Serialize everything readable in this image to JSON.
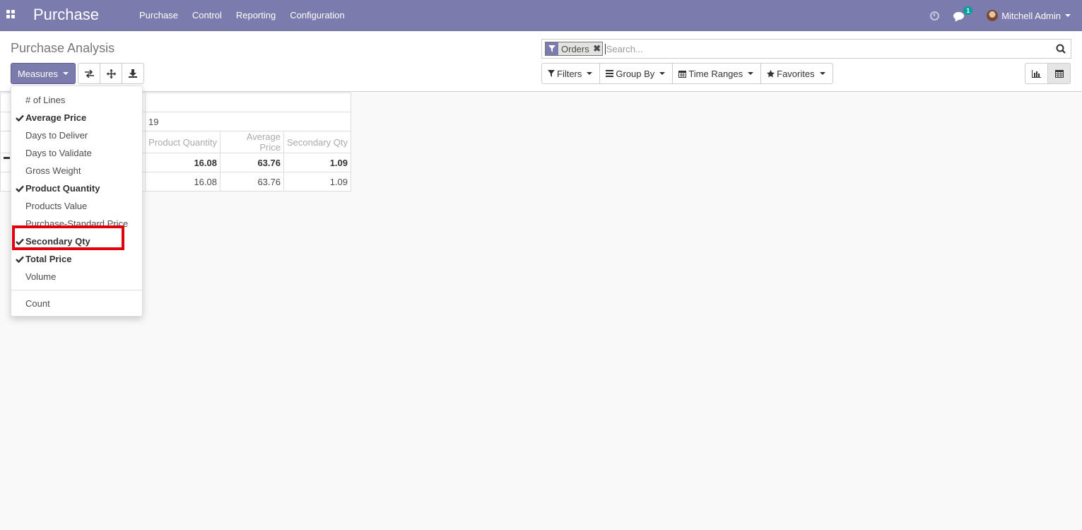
{
  "navbar": {
    "brand": "Purchase",
    "menu": [
      "Purchase",
      "Control",
      "Reporting",
      "Configuration"
    ],
    "chat_count": "1",
    "user_name": "Mitchell Admin",
    "bg_color": "#7c7bad"
  },
  "control_panel": {
    "title": "Purchase Analysis",
    "measures_label": "Measures",
    "search": {
      "facet_label": "Orders",
      "placeholder": "Search..."
    },
    "filters_label": "Filters",
    "groupby_label": "Group By",
    "timeranges_label": "Time Ranges",
    "favorites_label": "Favorites"
  },
  "pivot": {
    "col_header_partial": "19",
    "measures": [
      "Product Quantity",
      "Average Price",
      "Secondary Qty"
    ],
    "total_row": [
      "16.08",
      "63.76",
      "1.09"
    ],
    "row1": [
      "16.08",
      "63.76",
      "1.09"
    ]
  },
  "measures_menu": {
    "items": [
      {
        "label": "# of Lines",
        "checked": false
      },
      {
        "label": "Average Price",
        "checked": true
      },
      {
        "label": "Days to Deliver",
        "checked": false
      },
      {
        "label": "Days to Validate",
        "checked": false
      },
      {
        "label": "Gross Weight",
        "checked": false
      },
      {
        "label": "Product Quantity",
        "checked": true
      },
      {
        "label": "Products Value",
        "checked": false
      },
      {
        "label": "Purchase-Standard Price",
        "checked": false
      },
      {
        "label": "Secondary Qty",
        "checked": true
      },
      {
        "label": "Total Price",
        "checked": true
      },
      {
        "label": "Volume",
        "checked": false
      }
    ],
    "count_label": "Count",
    "highlight_color": "#e0000e"
  }
}
